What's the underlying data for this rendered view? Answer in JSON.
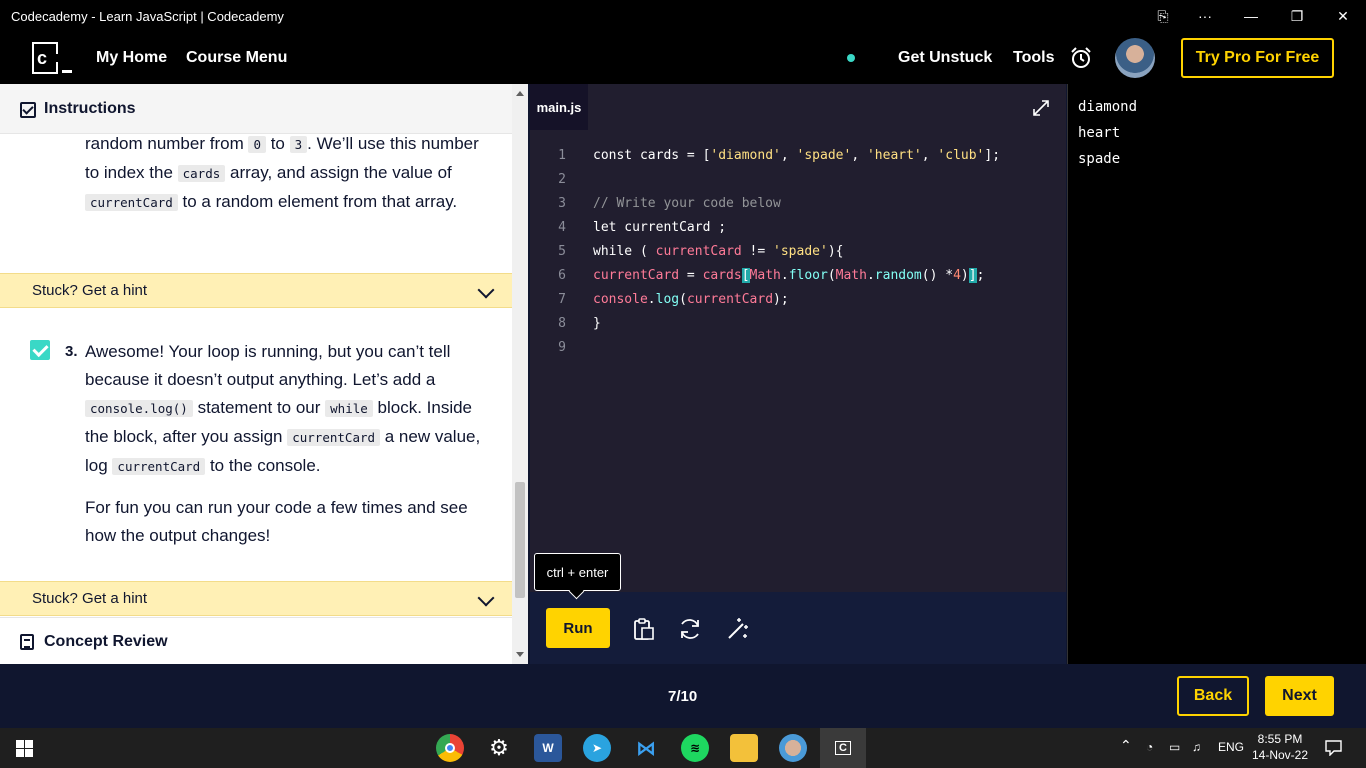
{
  "window": {
    "title": "Codecademy - Learn JavaScript | Codecademy",
    "controls": [
      "⎘",
      "···",
      "—",
      "❐",
      "✕"
    ]
  },
  "nav": {
    "my_home": "My Home",
    "course_menu": "Course Menu",
    "get_unstuck": "Get Unstuck",
    "tools": "Tools",
    "try_pro": "Try Pro For Free",
    "logo_letter": "c"
  },
  "instructions": {
    "header": "Instructions",
    "step2_text": [
      {
        "t": "random number from "
      },
      {
        "c": "0"
      },
      {
        "t": " to "
      },
      {
        "c": "3"
      },
      {
        "t": ". We’ll use this number to index the "
      },
      {
        "c": "cards"
      },
      {
        "t": " array, and assign the value of "
      },
      {
        "c": "currentCard"
      },
      {
        "t": " to a random element from that array."
      }
    ],
    "hint_label": "Stuck? Get a hint",
    "step3_number": "3.",
    "step3_text": [
      {
        "t": "Awesome! Your loop is running, but you can’t tell because it doesn’t output anything. Let’s add a "
      },
      {
        "c": "console.log()"
      },
      {
        "t": " statement to our "
      },
      {
        "c": "while"
      },
      {
        "t": " block. Inside the block, after you assign "
      },
      {
        "c": "currentCard"
      },
      {
        "t": " a new value, log "
      },
      {
        "c": "currentCard"
      },
      {
        "t": " to the console."
      }
    ],
    "step3_extra": "For fun you can run your code a few times and see how the output changes!",
    "hint_label_2": "Stuck? Get a hint",
    "concept_review": "Concept Review"
  },
  "editor": {
    "tab": "main.js",
    "lines": [
      [
        {
          "k": "kw",
          "v": "const cards = ["
        },
        {
          "k": "str",
          "v": "'diamond'"
        },
        {
          "k": "kw",
          "v": ", "
        },
        {
          "k": "str",
          "v": "'spade'"
        },
        {
          "k": "kw",
          "v": ", "
        },
        {
          "k": "str",
          "v": "'heart'"
        },
        {
          "k": "kw",
          "v": ", "
        },
        {
          "k": "str",
          "v": "'club'"
        },
        {
          "k": "kw",
          "v": "];"
        }
      ],
      [],
      [
        {
          "k": "cm",
          "v": "// Write your code below"
        }
      ],
      [
        {
          "k": "kw",
          "v": "let currentCard ;"
        }
      ],
      [
        {
          "k": "kw",
          "v": "while ( "
        },
        {
          "k": "var",
          "v": "currentCard"
        },
        {
          "k": "kw",
          "v": " != "
        },
        {
          "k": "str",
          "v": "'spade'"
        },
        {
          "k": "kw",
          "v": "){"
        }
      ],
      [
        {
          "k": "var",
          "v": "currentCard"
        },
        {
          "k": "kw",
          "v": " = "
        },
        {
          "k": "var",
          "v": "cards"
        },
        {
          "k": "cursor",
          "v": "["
        },
        {
          "k": "var",
          "v": "Math"
        },
        {
          "k": "kw",
          "v": "."
        },
        {
          "k": "fn",
          "v": "floor"
        },
        {
          "k": "kw",
          "v": "("
        },
        {
          "k": "var",
          "v": "Math"
        },
        {
          "k": "kw",
          "v": "."
        },
        {
          "k": "fn",
          "v": "random"
        },
        {
          "k": "kw",
          "v": "() *"
        },
        {
          "k": "num",
          "v": "4"
        },
        {
          "k": "kw",
          "v": ")"
        },
        {
          "k": "cursor",
          "v": "]"
        },
        {
          "k": "kw",
          "v": ";"
        }
      ],
      [
        {
          "k": "var",
          "v": "console"
        },
        {
          "k": "kw",
          "v": "."
        },
        {
          "k": "fn",
          "v": "log"
        },
        {
          "k": "kw",
          "v": "("
        },
        {
          "k": "var",
          "v": "currentCard"
        },
        {
          "k": "kw",
          "v": ");"
        }
      ],
      [
        {
          "k": "kw",
          "v": "}"
        }
      ],
      []
    ],
    "run_label": "Run",
    "tooltip": "ctrl + enter"
  },
  "output": {
    "lines": [
      "diamond",
      "heart",
      "spade"
    ]
  },
  "footer": {
    "progress": "7/10",
    "back": "Back",
    "next": "Next"
  },
  "taskbar": {
    "apps": [
      "chrome",
      "settings",
      "word",
      "telegram",
      "vscode",
      "spotify",
      "file-explorer",
      "browser-profile",
      "codecademy"
    ],
    "lang": "ENG",
    "time": "8:55 PM",
    "date": "14-Nov-22"
  },
  "colors": {
    "accent": "#ffd300",
    "nav_bg": "#000000",
    "editor_bg": "#211e2f",
    "hint_bg": "#fff0b5",
    "success": "#3ad8c6"
  }
}
